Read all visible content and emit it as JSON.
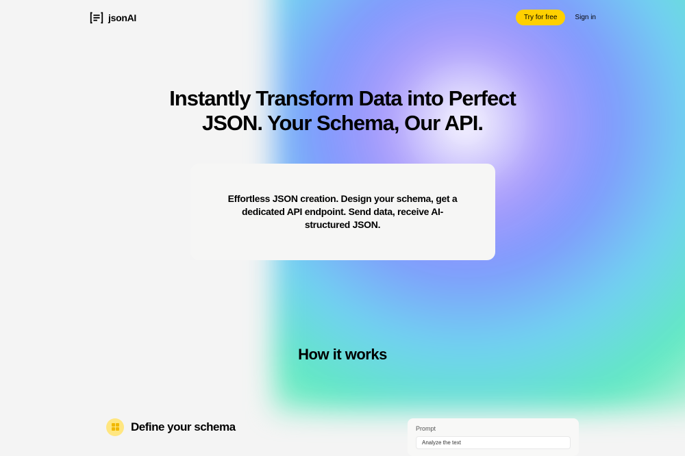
{
  "header": {
    "logo_text": "jsonAI",
    "try_button": "Try for free",
    "signin": "Sign in"
  },
  "hero": {
    "title_line1": "Instantly Transform Data into Perfect",
    "title_line2": "JSON. Your Schema, Our API.",
    "card_text": "Effortless JSON creation. Design your schema, get a dedicated API endpoint. Send data, receive AI-structured JSON."
  },
  "how": {
    "title": "How it works",
    "step1_title": "Define your schema",
    "prompt_label": "Prompt",
    "prompt_value": "Analyze the text"
  }
}
